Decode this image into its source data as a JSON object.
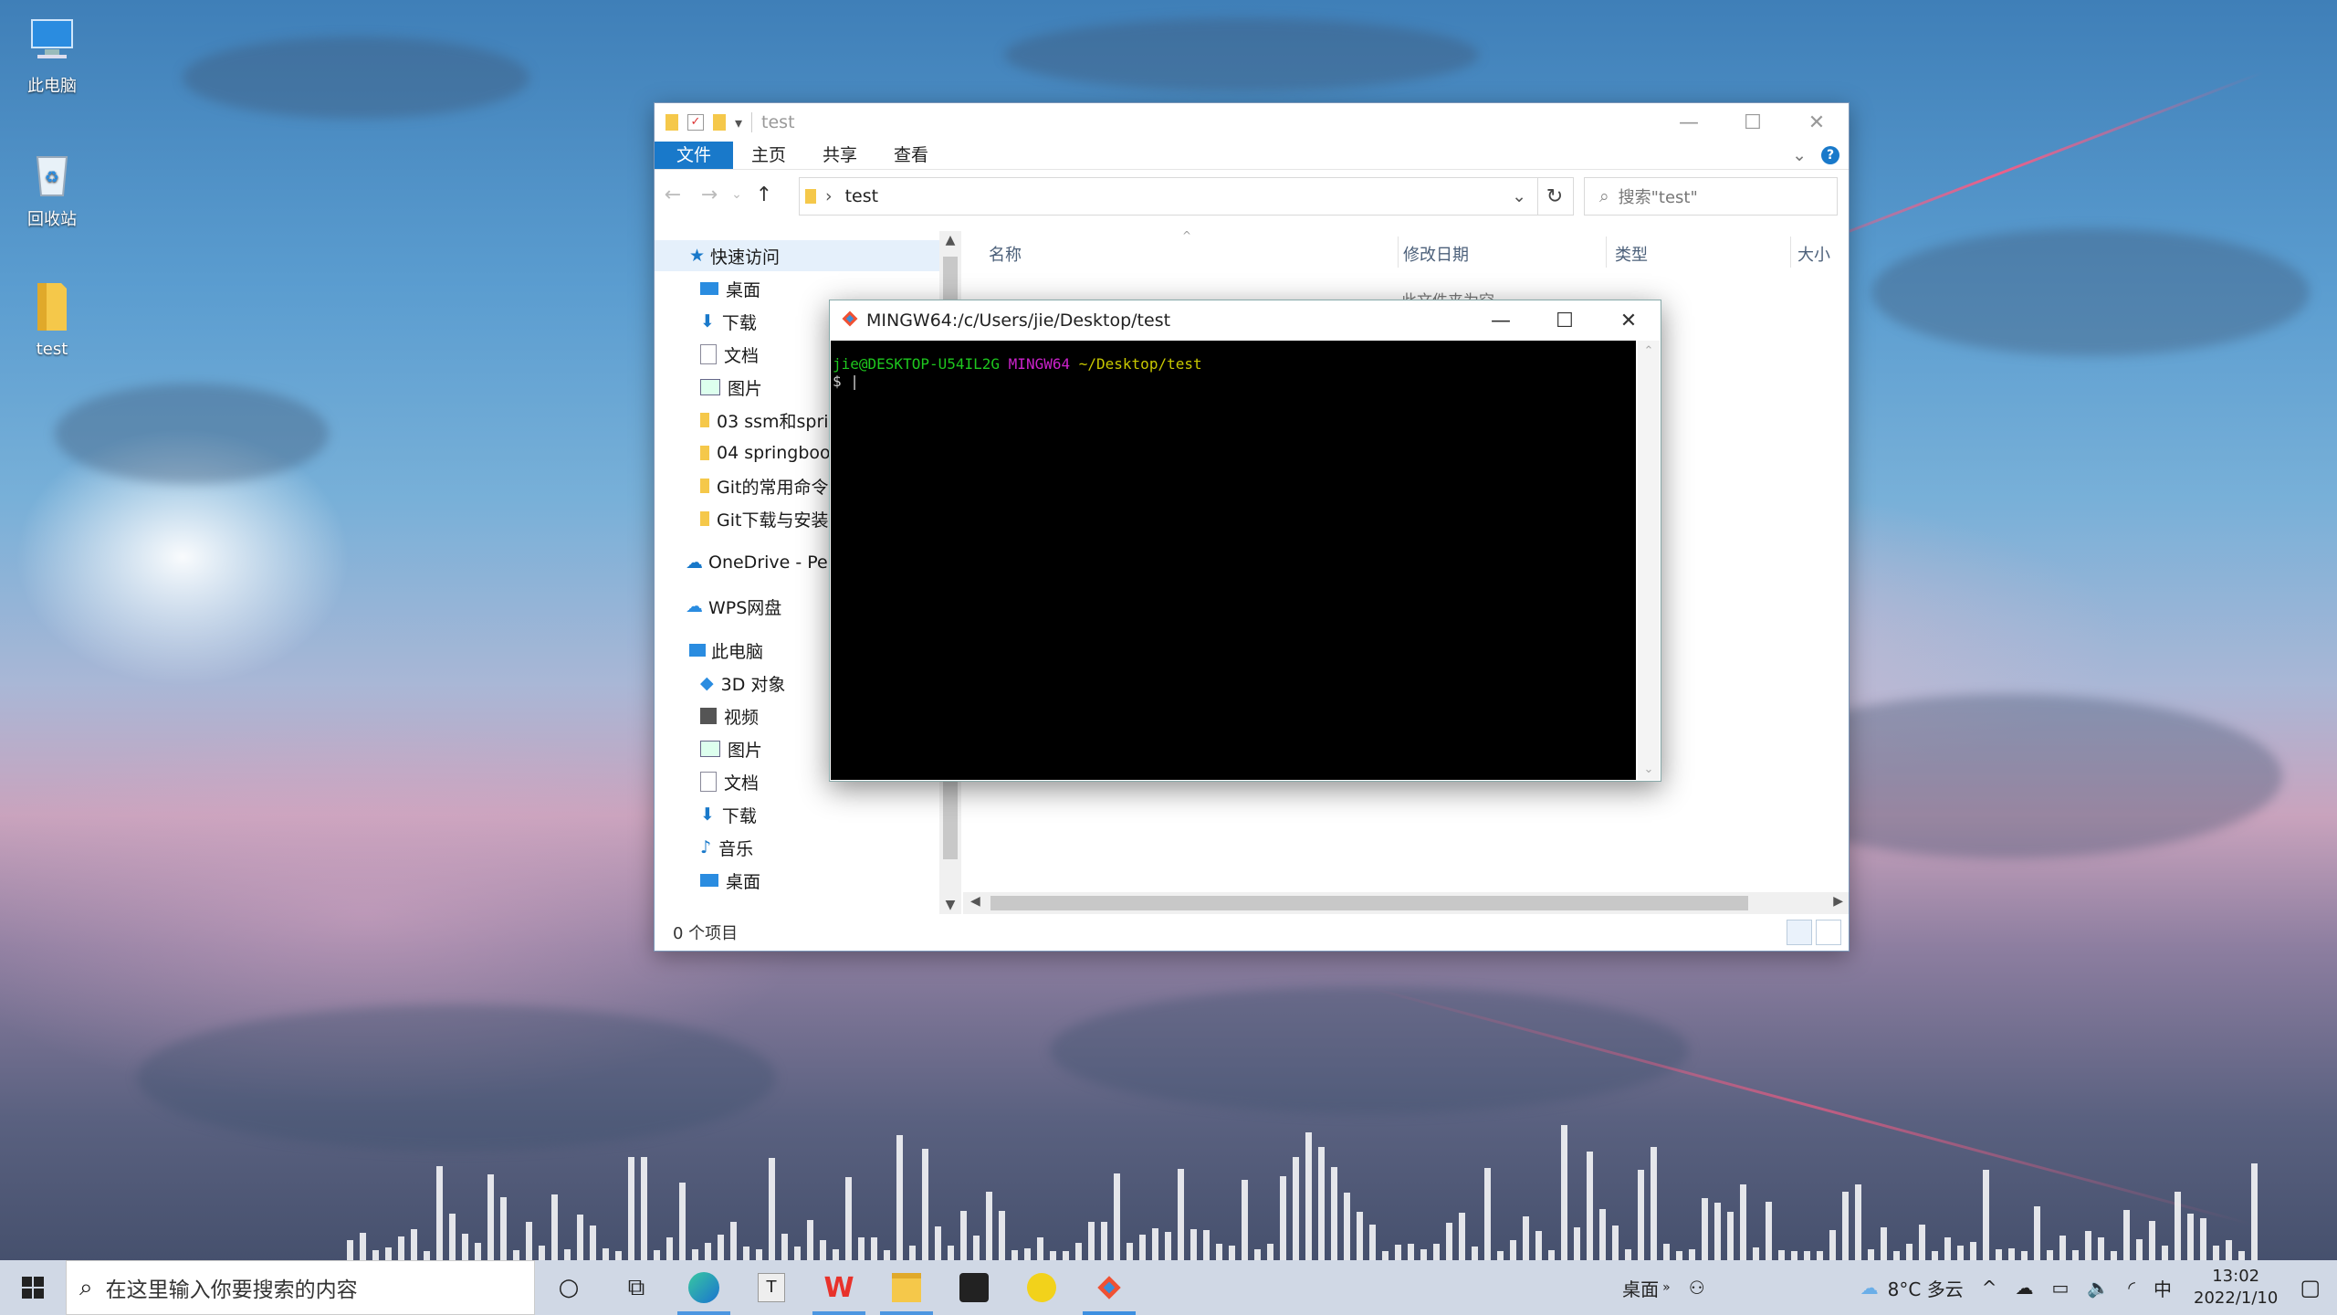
{
  "desktop": {
    "icons": [
      {
        "label": "此电脑"
      },
      {
        "label": "回收站"
      },
      {
        "label": "test"
      }
    ]
  },
  "explorer": {
    "title": "test",
    "ribbon_tabs": [
      "文件",
      "主页",
      "共享",
      "查看"
    ],
    "address": "test",
    "search_placeholder": "搜索\"test\"",
    "nav_items": [
      "快速访问",
      "桌面",
      "下载",
      "文档",
      "图片",
      "03 ssm和sprir",
      "04 springboo",
      "Git的常用命令",
      "Git下载与安装",
      "OneDrive - Pers",
      "WPS网盘",
      "此电脑",
      "3D 对象",
      "视频",
      "图片",
      "文档",
      "下载",
      "音乐",
      "桌面"
    ],
    "columns": [
      "名称",
      "修改日期",
      "类型",
      "大小"
    ],
    "empty_message": "此文件夹为空。",
    "status": "0 个项目"
  },
  "terminal": {
    "title": "MINGW64:/c/Users/jie/Desktop/test",
    "prompt_user": "jie@DESKTOP-U54IL2G",
    "prompt_env": "MINGW64",
    "prompt_path": "~/Desktop/test",
    "prompt_symbol": "$"
  },
  "taskbar": {
    "search_placeholder": "在这里输入你要搜索的内容",
    "desktop_label": "桌面",
    "weather": "8°C 多云",
    "ime": "中",
    "time": "13:02",
    "date": "2022/1/10",
    "apps": [
      "edge-icon",
      "typora-icon",
      "wps-icon",
      "file-explorer-icon",
      "app-icon",
      "music-icon",
      "git-bash-icon"
    ]
  },
  "colors": {
    "accent": "#1979ca",
    "term_green": "#1ec71e",
    "term_magenta": "#cc22cc",
    "term_yellow": "#c8c800"
  }
}
